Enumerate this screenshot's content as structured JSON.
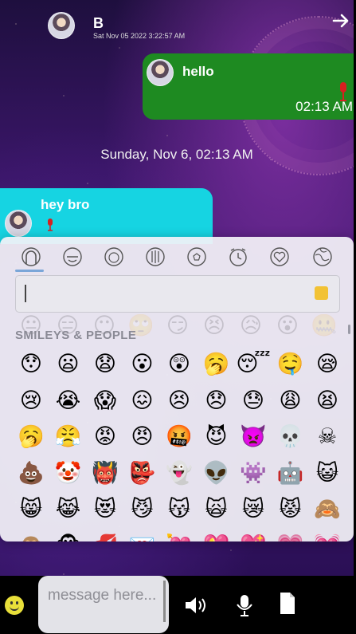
{
  "header": {
    "contact_name": "B",
    "last_seen": "Sat Nov 05 2022 3:22:57 AM",
    "back_icon": "arrow-right-icon"
  },
  "messages": [
    {
      "direction": "outgoing",
      "text": "hello",
      "time": "02:13 AM",
      "bubble_color": "#1e8a21"
    },
    {
      "direction": "incoming",
      "text": "hey bro",
      "bubble_color": "#16d4e2"
    }
  ],
  "date_separator": "Sunday, Nov 6, 02:13 AM",
  "emoji_picker": {
    "categories": [
      "recent-icon",
      "smileys-icon",
      "animals-icon",
      "food-icon",
      "activity-icon",
      "travel-icon",
      "objects-icon",
      "symbols-icon"
    ],
    "search_value": "",
    "category_title": "SMILEYS & PEOPLE",
    "emojis": [
      "😯",
      "😦",
      "😧",
      "😮",
      "😲",
      "🥱",
      "😴",
      "🤤",
      "😪",
      "😢",
      "😭",
      "😱",
      "😖",
      "😣",
      "😞",
      "😓",
      "😩",
      "😫",
      "🥱",
      "😤",
      "😡",
      "😠",
      "🤬",
      "😈",
      "👿",
      "💀",
      "☠",
      "💩",
      "🤡",
      "👹",
      "👺",
      "👻",
      "👽",
      "👾",
      "🤖",
      "😺",
      "😸",
      "😹",
      "😻",
      "😼",
      "😽",
      "🙀",
      "😿",
      "😾",
      "🙈",
      "🙉",
      "🐵",
      "💋",
      "💌",
      "💘",
      "💝",
      "💖",
      "💗",
      "💓"
    ],
    "accent": "#f2c234"
  },
  "composer": {
    "placeholder": "message here...",
    "emoji_icon": "smiley-icon",
    "speaker_icon": "speaker-icon",
    "mic_icon": "microphone-icon",
    "file_icon": "file-icon"
  }
}
